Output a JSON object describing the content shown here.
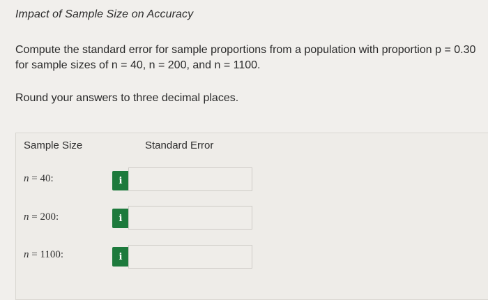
{
  "title": "Impact of Sample Size on Accuracy",
  "question": "Compute the standard error for sample proportions from a population with proportion p = 0.30 for sample sizes of n = 40, n = 200, and n = 1100.",
  "instruction": "Round your answers to three decimal places.",
  "table": {
    "header_sample_size": "Sample Size",
    "header_standard_error": "Standard Error",
    "rows": [
      {
        "var": "n",
        "eq": " = 40:",
        "value": ""
      },
      {
        "var": "n",
        "eq": " = 200:",
        "value": ""
      },
      {
        "var": "n",
        "eq": " = 1100:",
        "value": ""
      }
    ]
  },
  "info_icon_glyph": "i",
  "colors": {
    "info_button": "#1d7a3c",
    "background": "#f1efec"
  }
}
